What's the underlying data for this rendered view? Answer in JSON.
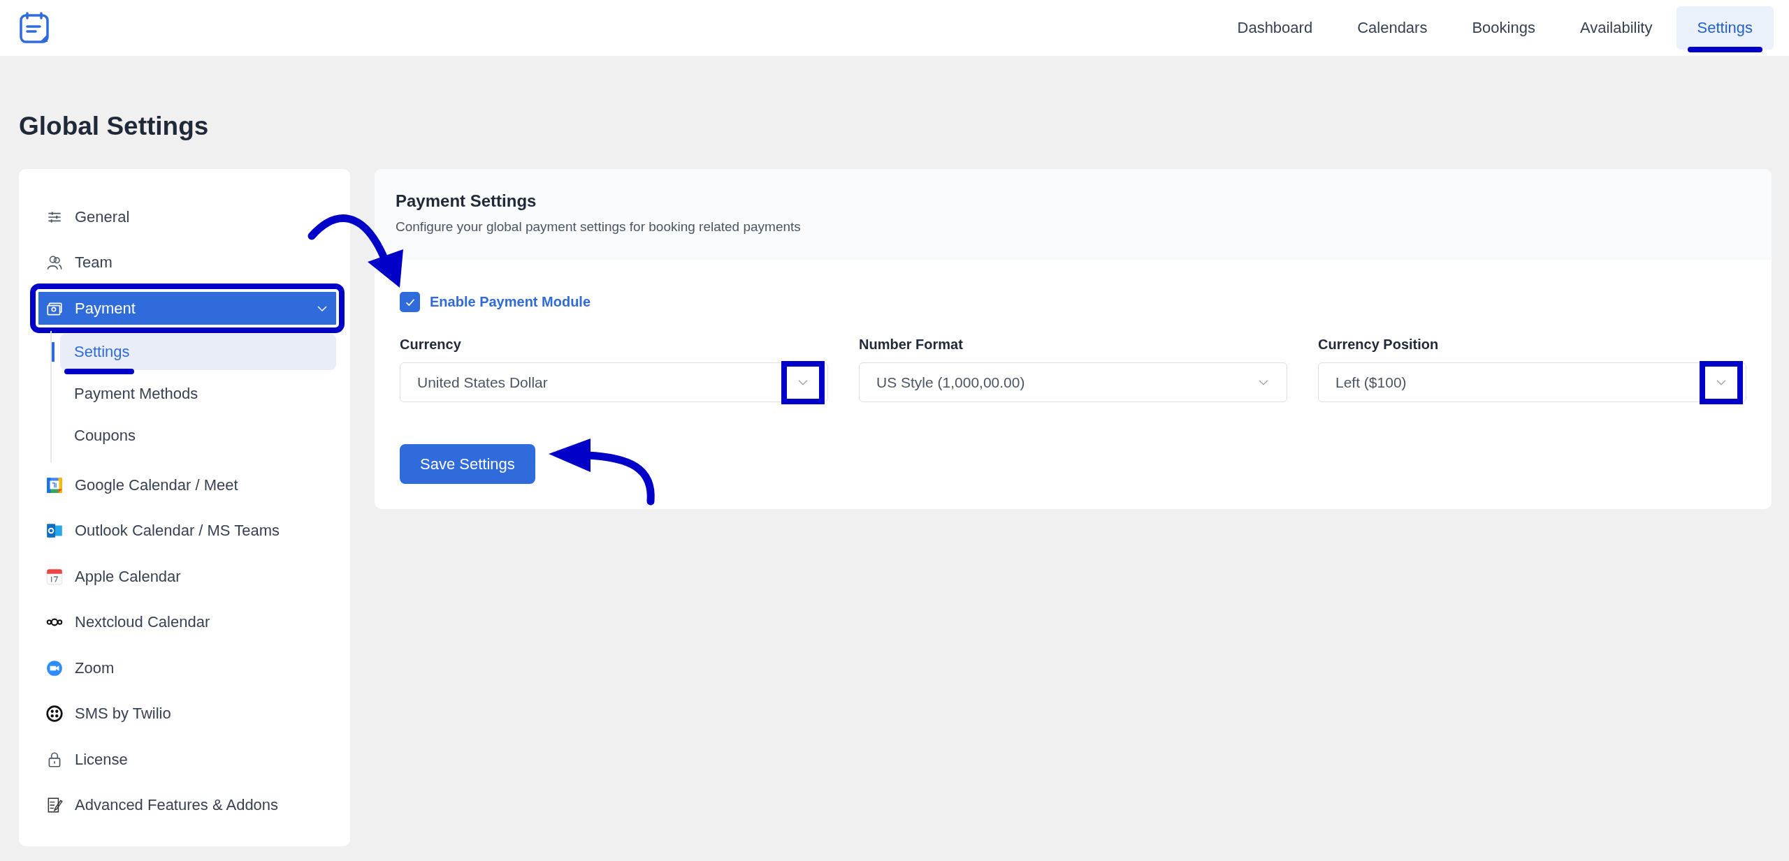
{
  "header": {
    "nav": [
      {
        "label": "Dashboard",
        "selected": false,
        "annotated": false
      },
      {
        "label": "Calendars",
        "selected": false,
        "annotated": false
      },
      {
        "label": "Bookings",
        "selected": false,
        "annotated": false
      },
      {
        "label": "Availability",
        "selected": false,
        "annotated": false
      },
      {
        "label": "Settings",
        "selected": true,
        "annotated": true
      }
    ]
  },
  "page_title": "Global Settings",
  "sidebar": {
    "items": [
      {
        "label": "General",
        "selected": false,
        "expanded": false,
        "annotated": false
      },
      {
        "label": "Team",
        "selected": false,
        "expanded": false,
        "annotated": false
      },
      {
        "label": "Payment",
        "selected": true,
        "expanded": true,
        "annotated": true,
        "children": [
          {
            "label": "Settings",
            "selected": true,
            "annotated": true
          },
          {
            "label": "Payment Methods",
            "selected": false,
            "annotated": false
          },
          {
            "label": "Coupons",
            "selected": false,
            "annotated": false
          }
        ]
      },
      {
        "label": "Google Calendar / Meet",
        "selected": false,
        "expanded": false,
        "annotated": false
      },
      {
        "label": "Outlook Calendar / MS Teams",
        "selected": false,
        "expanded": false,
        "annotated": false
      },
      {
        "label": "Apple Calendar",
        "selected": false,
        "expanded": false,
        "annotated": false
      },
      {
        "label": "Nextcloud Calendar",
        "selected": false,
        "expanded": false,
        "annotated": false
      },
      {
        "label": "Zoom",
        "selected": false,
        "expanded": false,
        "annotated": false
      },
      {
        "label": "SMS by Twilio",
        "selected": false,
        "expanded": false,
        "annotated": false
      },
      {
        "label": "License",
        "selected": false,
        "expanded": false,
        "annotated": false
      },
      {
        "label": "Advanced Features & Addons",
        "selected": false,
        "expanded": false,
        "annotated": false
      }
    ]
  },
  "panel": {
    "title": "Payment Settings",
    "subtitle": "Configure your global payment settings for booking related payments",
    "enable_checkbox": {
      "label": "Enable Payment Module",
      "checked": true,
      "annotated": true
    },
    "fields": [
      {
        "label": "Currency",
        "value": "United States Dollar",
        "annotated": true
      },
      {
        "label": "Number Format",
        "value": "US Style (1,000,00.00)",
        "annotated": false
      },
      {
        "label": "Currency Position",
        "value": "Left ($100)",
        "annotated": true
      }
    ],
    "save_button": {
      "label": "Save Settings",
      "annotated": true
    }
  }
}
